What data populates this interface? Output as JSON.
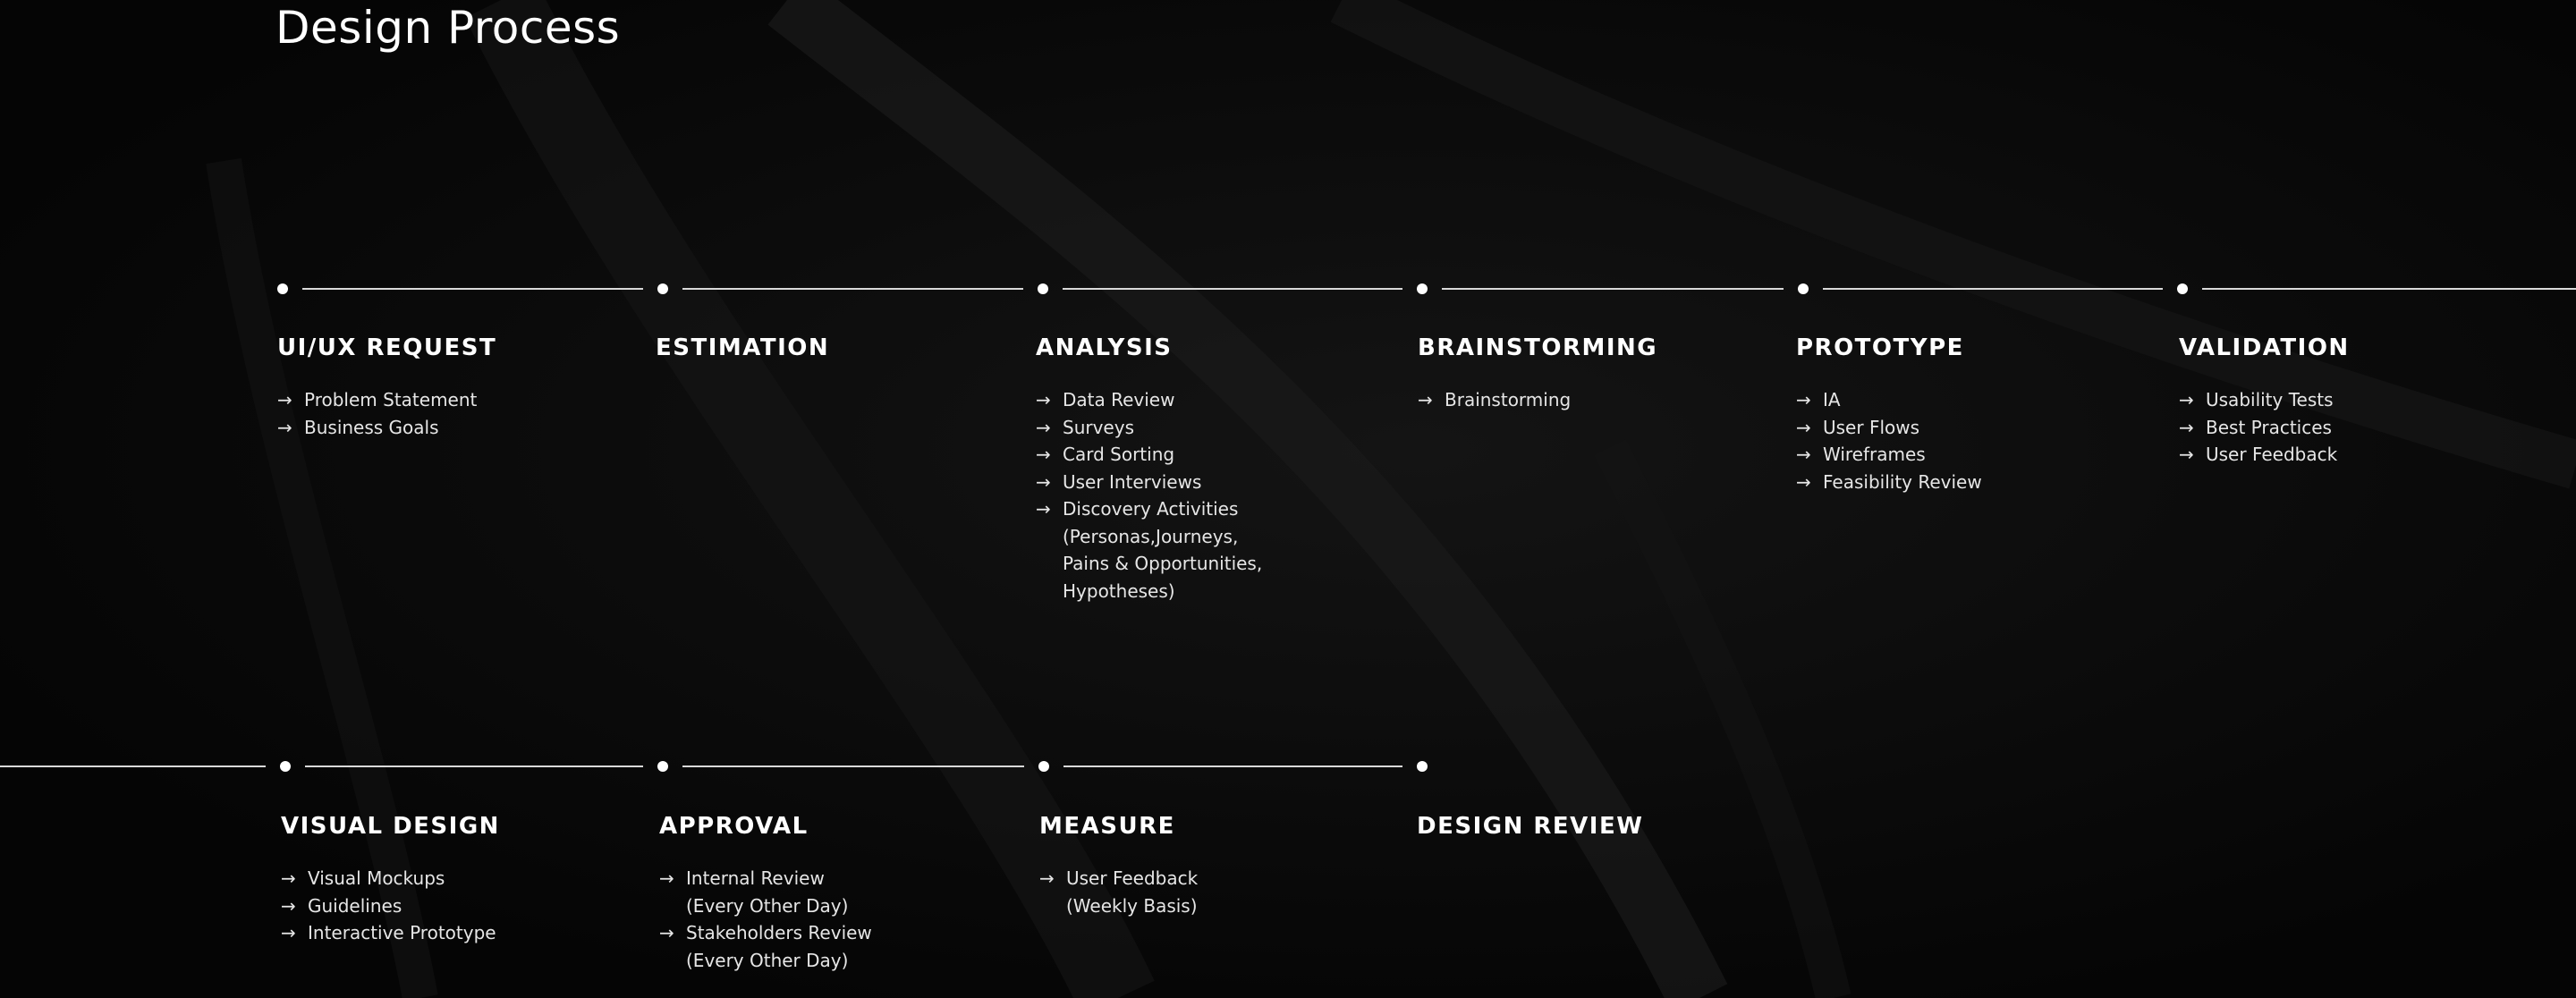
{
  "page": {
    "title": "Design Process",
    "background_color": "#050505",
    "text_color": "#ffffff",
    "line_color": "#d9d9d9"
  },
  "icons": {
    "item_marker": "arrow-right-icon",
    "item_marker_glyph": "→",
    "node_marker": "dot-icon"
  },
  "rows": [
    {
      "steps": [
        {
          "title": "UI/UX REQUEST",
          "items": [
            "Problem Statement",
            "Business Goals"
          ]
        },
        {
          "title": "ESTIMATION",
          "items": []
        },
        {
          "title": "ANALYSIS",
          "items": [
            "Data Review",
            "Surveys",
            "Card Sorting",
            "User Interviews",
            "Discovery Activities\n(Personas,Journeys,\nPains & Opportunities,\nHypotheses)"
          ]
        },
        {
          "title": "BRAINSTORMING",
          "items": [
            "Brainstorming"
          ]
        },
        {
          "title": "PROTOTYPE",
          "items": [
            "IA",
            "User Flows",
            "Wireframes",
            "Feasibility Review"
          ]
        },
        {
          "title": "VALIDATION",
          "items": [
            "Usability Tests",
            "Best Practices",
            "User Feedback"
          ]
        }
      ]
    },
    {
      "steps": [
        {
          "title": "VISUAL DESIGN",
          "items": [
            "Visual Mockups",
            "Guidelines",
            "Interactive Prototype"
          ]
        },
        {
          "title": "APPROVAL",
          "items": [
            "Internal Review\n(Every Other Day)",
            "Stakeholders Review\n(Every Other Day)"
          ]
        },
        {
          "title": "MEASURE",
          "items": [
            "User Feedback\n(Weekly Basis)"
          ]
        },
        {
          "title": "DESIGN REVIEW",
          "items": []
        }
      ]
    }
  ]
}
